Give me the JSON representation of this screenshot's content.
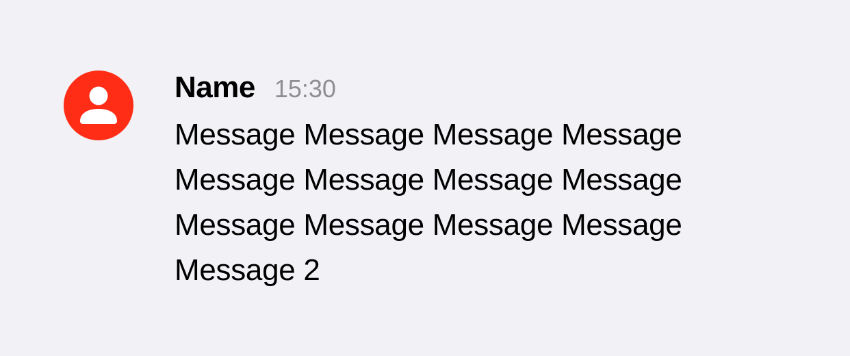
{
  "message": {
    "sender_name": "Name",
    "timestamp": "15:30",
    "text": "Message Message Message Message Message Message Message Message Message Message Message Message Message 2",
    "avatar_icon": "person-icon",
    "avatar_color": "#ff2d16"
  }
}
